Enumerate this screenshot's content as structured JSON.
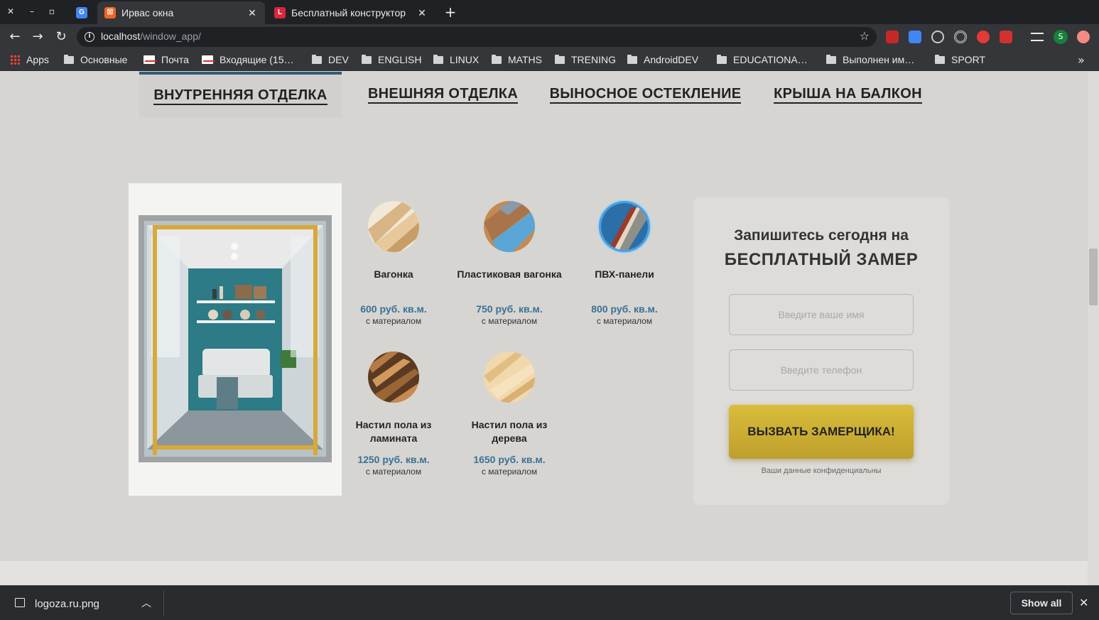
{
  "browser": {
    "tabs": [
      {
        "title": "Ирвас окна",
        "active": true
      },
      {
        "title": "Бесплатный конструктор",
        "active": false
      }
    ],
    "url_host": "localhost",
    "url_path": "/window_app/",
    "profile_initial": "S",
    "bookmarks": [
      "Apps",
      "Основные",
      "Почта",
      "Входящие (15…",
      "DEV",
      "ENGLISH",
      "LINUX",
      "MATHS",
      "TRENING",
      "AndroidDEV",
      "EDUCATIONA…",
      "Выполнен им…",
      "SPORT"
    ]
  },
  "page": {
    "categories": [
      "ВНУТРЕННЯЯ ОТДЕЛКА",
      "ВНЕШНЯЯ ОТДЕЛКА",
      "ВЫНОСНОЕ ОСТЕКЛЕНИЕ",
      "КРЫША НА БАЛКОН"
    ],
    "active_category": 0,
    "products": [
      {
        "name": "Вагонка",
        "price": "600 руб. кв.м.",
        "unit": "с материалом"
      },
      {
        "name": "Пластиковая вагонка",
        "price": "750 руб. кв.м.",
        "unit": "с материалом"
      },
      {
        "name": "ПВХ-панели",
        "price": "800 руб. кв.м.",
        "unit": "с материалом"
      },
      {
        "name": "Настил пола из ламината",
        "price": "1250 руб. кв.м.",
        "unit": "с материалом"
      },
      {
        "name": "Настил пола из дерева",
        "price": "1650 руб. кв.м.",
        "unit": "с материалом"
      }
    ],
    "form": {
      "subtitle": "Запишитесь сегодня на",
      "headline": "БЕСПЛАТНЫЙ ЗАМЕР",
      "name_placeholder": "Введите ваше имя",
      "phone_placeholder": "Введите телефон",
      "button": "ВЫЗВАТЬ ЗАМЕРЩИКА!",
      "note": "Ваши данные конфиденциальны"
    }
  },
  "downloads": {
    "file": "logoza.ru.png",
    "show_all": "Show all"
  },
  "colors": {
    "accent_blue": "#3a7196",
    "cta_gold": "#c9aa32",
    "page_bg": "#d6d5d1"
  }
}
